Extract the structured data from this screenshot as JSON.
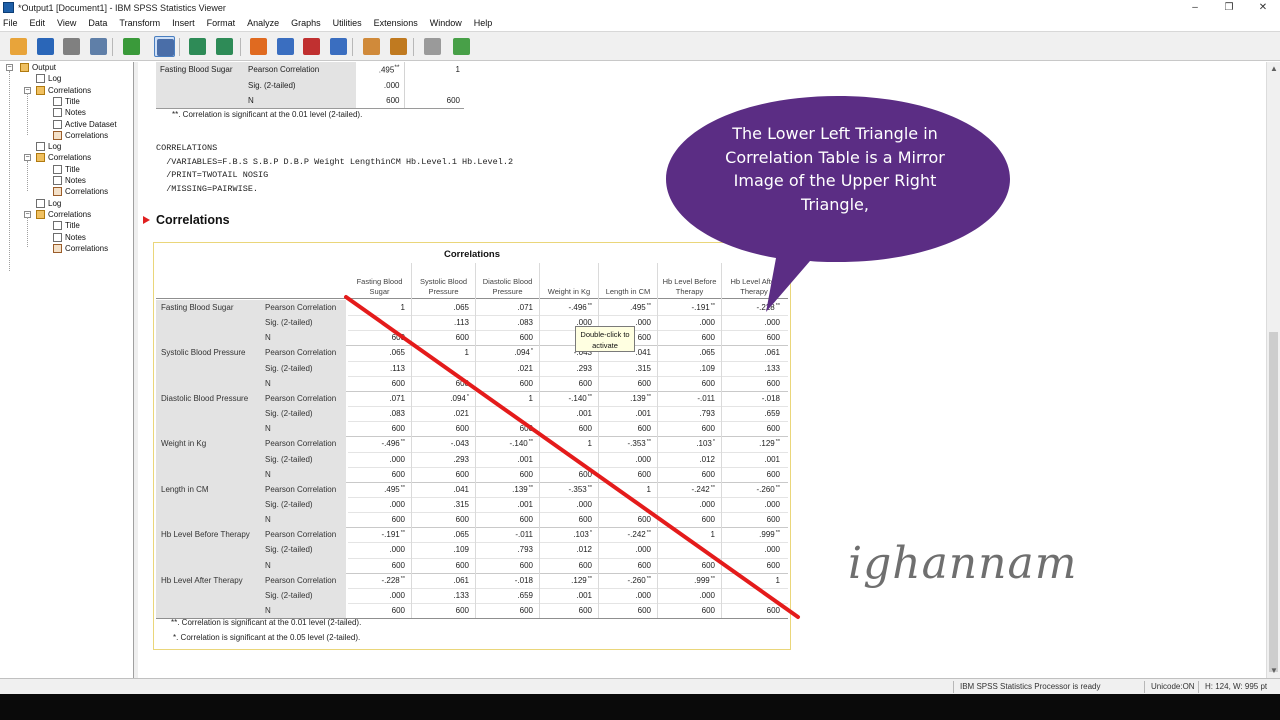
{
  "window": {
    "title": "*Output1 [Document1] - IBM SPSS Statistics Viewer",
    "controls": [
      "–",
      "❐",
      "✕"
    ]
  },
  "menu": [
    "File",
    "Edit",
    "View",
    "Data",
    "Transform",
    "Insert",
    "Format",
    "Analyze",
    "Graphs",
    "Utilities",
    "Extensions",
    "Window",
    "Help"
  ],
  "toolbar": {
    "buttons": [
      {
        "name": "open-icon",
        "color": "#e8a43a"
      },
      {
        "name": "save-icon",
        "color": "#2a66b8"
      },
      {
        "name": "print-icon",
        "color": "#808080"
      },
      {
        "name": "print-preview-icon",
        "color": "#5f7fa8"
      },
      {
        "name": "export-icon",
        "color": "#3a9a3a"
      },
      {
        "name": "recall-dialog-icon",
        "color": "#4a6ea8"
      },
      {
        "name": "undo-icon",
        "color": "#2e8b57"
      },
      {
        "name": "redo-icon",
        "color": "#2e8b57"
      },
      {
        "name": "goto-data-icon",
        "color": "#e06a20"
      },
      {
        "name": "goto-case-icon",
        "color": "#3a6ec0"
      },
      {
        "name": "goto-variable-icon",
        "color": "#c03030"
      },
      {
        "name": "variables-icon",
        "color": "#3a6ec0"
      },
      {
        "name": "show-all-icon",
        "color": "#d08a3a"
      },
      {
        "name": "insert-output-icon",
        "color": "#c07a20"
      },
      {
        "name": "hide-icon",
        "color": "#9a9a9a"
      },
      {
        "name": "add-icon",
        "color": "#48a048"
      }
    ]
  },
  "outline": {
    "items": [
      {
        "label": "Output",
        "level": 0,
        "icon": "book"
      },
      {
        "label": "Log",
        "level": 1,
        "icon": "doc"
      },
      {
        "label": "Correlations",
        "level": 1,
        "icon": "book"
      },
      {
        "label": "Title",
        "level": 2,
        "icon": "doc"
      },
      {
        "label": "Notes",
        "level": 2,
        "icon": "doc"
      },
      {
        "label": "Active Dataset",
        "level": 2,
        "icon": "doc"
      },
      {
        "label": "Correlations",
        "level": 2,
        "icon": "tbl"
      },
      {
        "label": "Log",
        "level": 1,
        "icon": "doc"
      },
      {
        "label": "Correlations",
        "level": 1,
        "icon": "book"
      },
      {
        "label": "Title",
        "level": 2,
        "icon": "doc"
      },
      {
        "label": "Notes",
        "level": 2,
        "icon": "doc"
      },
      {
        "label": "Correlations",
        "level": 2,
        "icon": "tbl"
      },
      {
        "label": "Log",
        "level": 1,
        "icon": "doc"
      },
      {
        "label": "Correlations",
        "level": 1,
        "icon": "book"
      },
      {
        "label": "Title",
        "level": 2,
        "icon": "doc"
      },
      {
        "label": "Notes",
        "level": 2,
        "icon": "doc"
      },
      {
        "label": "Correlations",
        "level": 2,
        "icon": "tbl"
      }
    ]
  },
  "top_table": {
    "rows": [
      [
        "Fasting Blood Sugar",
        "Pearson Correlation",
        ".495**",
        "1"
      ],
      [
        "",
        "Sig. (2-tailed)",
        ".000",
        ""
      ],
      [
        "",
        "N",
        "600",
        "600"
      ]
    ],
    "footnote": "**. Correlation is significant at the 0.01 level (2-tailed)."
  },
  "syntax": "CORRELATIONS\n  /VARIABLES=F.B.S S.B.P D.B.P Weight LengthinCM Hb.Level.1 Hb.Level.2\n  /PRINT=TWOTAIL NOSIG\n  /MISSING=PAIRWISE.",
  "section_heading": "Correlations",
  "correlations": {
    "title": "Correlations",
    "columns": [
      "Fasting Blood Sugar",
      "Systolic Blood Pressure",
      "Diastolic Blood Pressure",
      "Weight in Kg",
      "Length in CM",
      "Hb Level Before Therapy",
      "Hb Level After Therapy"
    ],
    "stat_labels": [
      "Pearson Correlation",
      "Sig. (2-tailed)",
      "N"
    ],
    "rows": [
      {
        "label": "Fasting Blood Sugar",
        "r": [
          "1",
          ".065",
          ".071",
          "-.496**",
          ".495**",
          "-.191**",
          "-.228**"
        ],
        "sig": [
          "",
          ".113",
          ".083",
          ".000",
          ".000",
          ".000",
          ".000"
        ],
        "n": [
          "600",
          "600",
          "600",
          "600",
          "600",
          "600",
          "600"
        ]
      },
      {
        "label": "Systolic Blood Pressure",
        "r": [
          ".065",
          "1",
          ".094*",
          "-.043",
          ".041",
          ".065",
          ".061"
        ],
        "sig": [
          ".113",
          "",
          ".021",
          ".293",
          ".315",
          ".109",
          ".133"
        ],
        "n": [
          "600",
          "600",
          "600",
          "600",
          "600",
          "600",
          "600"
        ]
      },
      {
        "label": "Diastolic Blood Pressure",
        "r": [
          ".071",
          ".094*",
          "1",
          "-.140**",
          ".139**",
          "-.011",
          "-.018"
        ],
        "sig": [
          ".083",
          ".021",
          "",
          ".001",
          ".001",
          ".793",
          ".659"
        ],
        "n": [
          "600",
          "600",
          "600",
          "600",
          "600",
          "600",
          "600"
        ]
      },
      {
        "label": "Weight in Kg",
        "r": [
          "-.496**",
          "-.043",
          "-.140**",
          "1",
          "-.353**",
          ".103*",
          ".129**"
        ],
        "sig": [
          ".000",
          ".293",
          ".001",
          "",
          ".000",
          ".012",
          ".001"
        ],
        "n": [
          "600",
          "600",
          "600",
          "600",
          "600",
          "600",
          "600"
        ]
      },
      {
        "label": "Length in CM",
        "r": [
          ".495**",
          ".041",
          ".139**",
          "-.353**",
          "1",
          "-.242**",
          "-.260**"
        ],
        "sig": [
          ".000",
          ".315",
          ".001",
          ".000",
          "",
          ".000",
          ".000"
        ],
        "n": [
          "600",
          "600",
          "600",
          "600",
          "600",
          "600",
          "600"
        ]
      },
      {
        "label": "Hb Level Before Therapy",
        "r": [
          "-.191**",
          ".065",
          "-.011",
          ".103*",
          "-.242**",
          "1",
          ".999**"
        ],
        "sig": [
          ".000",
          ".109",
          ".793",
          ".012",
          ".000",
          "",
          ".000"
        ],
        "n": [
          "600",
          "600",
          "600",
          "600",
          "600",
          "600",
          "600"
        ]
      },
      {
        "label": "Hb Level After Therapy",
        "r": [
          "-.228**",
          ".061",
          "-.018",
          ".129**",
          "-.260**",
          ".999**",
          "1"
        ],
        "sig": [
          ".000",
          ".133",
          ".659",
          ".001",
          ".000",
          ".000",
          ""
        ],
        "n": [
          "600",
          "600",
          "600",
          "600",
          "600",
          "600",
          "600"
        ]
      }
    ],
    "footnotes": [
      "**. Correlation is significant at the 0.01 level (2-tailed).",
      "*. Correlation is significant at the 0.05 level (2-tailed)."
    ]
  },
  "tooltip": "Double-click to activate",
  "annotation": {
    "bubble_text": "The Lower Left Triangle in Correlation Table is a Mirror Image of the Upper Right Triangle,",
    "bubble_color": "#5b2d84",
    "diagonal_color": "#e41b1b"
  },
  "signature": "ighannam",
  "status": {
    "processor": "IBM SPSS Statistics Processor is ready",
    "unicode": "Unicode:ON",
    "dimensions": "H: 124, W: 995 pt"
  }
}
